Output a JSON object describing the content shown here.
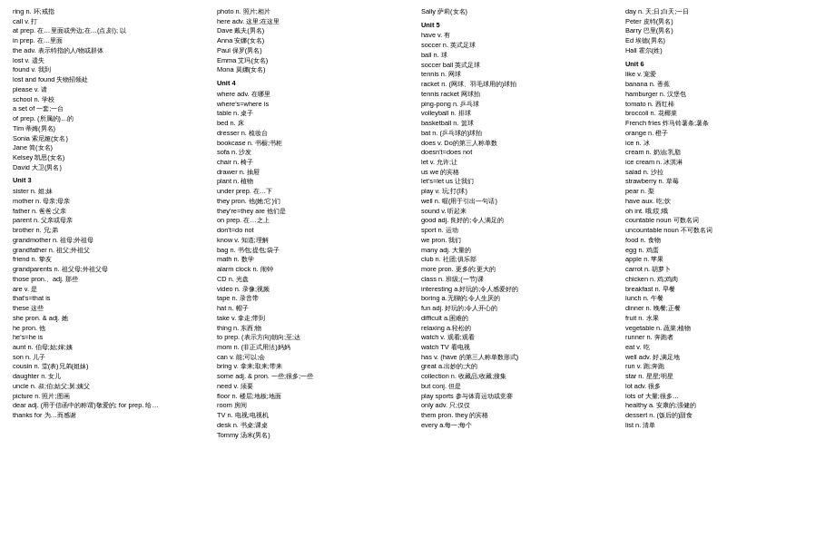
{
  "columns": [
    {
      "id": "col1",
      "entries": [
        "ring n. 环;戒指",
        "call v. 打",
        "at prep. 在…里面或旁边;在…(点,刻); 以",
        "in prep. 在…里面",
        "the adv. 表示特指的人/物或群体",
        "lost v. 遗失",
        "found v. 我到",
        "lost and found 失物招领处",
        "please v. 请",
        "school n. 学校",
        "a set of 一套;一台",
        "of prep. (所属的)…的",
        "Tim 蒂姆(男名)",
        "Sonia 索尼娅(女名)",
        "Jane 简(女名)",
        "Kelsey 凯思(女名)",
        "David 大卫(男名)",
        "Unit 3",
        "sister n. 姐;妹",
        "mother n. 母亲;母亲",
        "father n. 爸爸;父亲",
        "parent n. 父亲或母亲",
        "brother n. 兄;弟",
        "grandmother n. 祖母;外祖母",
        "grandfather n. 祖父;外祖父",
        "friend n. 挚友",
        "grandparents n. 祖父母;外祖父母",
        "those pron.、adj. 那些",
        "are v. 是",
        "that's=that is",
        "these 这些",
        "she pron. & adj. 她",
        "he pron. 他",
        "he's=he is",
        "aunt n. 伯母;姑;婶;姨",
        "son n. 儿子",
        "cousin n. 堂(表)兄弟(姐妹)",
        "daughter n. 女儿",
        "uncle n. 叔;伯;姑父;舅;姨父",
        "picture n. 照片;图画",
        "dear adj. (用于信函中的称谓)敬爱的; for prep. 给…",
        "thanks for 为…而感谢"
      ]
    },
    {
      "id": "col2",
      "entries": [
        "photo n. 照片;相片",
        "here adv. 这里;在这里",
        "Dave 戴夫(男名)",
        "Anna 安娜(女名)",
        "Paul 保罗(男名)",
        "Emma 艾玛(女名)",
        "Mona 莫娜(女名)",
        "Unit 4",
        "where adv. 在哪里",
        "where's=where is",
        "table n. 桌子",
        "bed n. 床",
        "dresser n. 梳妆台",
        "bookcase n. 书橱;书柜",
        "sofa n. 沙发",
        "chair n. 椅子",
        "drawer n. 抽屉",
        "plant n. 植物",
        "under prep. 在…下",
        "they pron. 他(她;它)们",
        "they're=they are 他们是",
        "on prep. 在…之上",
        "don't=do not",
        "know v. 知道;理解",
        "bag n. 书包;提包;袋子",
        "math n. 数学",
        "alarm clock n. 闹钟",
        "CD n. 光盘",
        "video n. 录像;视频",
        "tape n. 录音带",
        "hat n. 帽子",
        "take v. 拿走;带到",
        "thing n. 东西;物",
        "to prep. (表示方向)朝向;至;达",
        "mom n. (非正式用法)妈妈",
        "can v. 能;可以;会",
        "bring v. 拿来;取来;带来",
        "some adj. & pron. 一些;很多;一些",
        "need v. 须要",
        "floor n. 楼层;地板;地面",
        "room 房间",
        "TV n. 电视;电视机",
        "desk n. 书桌;课桌",
        "Tommy 汤米(男名)"
      ]
    },
    {
      "id": "col3",
      "entries": [
        "Sally 萨莉(女名)",
        "Unit 5",
        "have v. 有",
        "soccer n. 英式足球",
        "ball n. 球",
        "soccer ball 英式足球",
        "tennis n. 网球",
        "racket n. (网球、羽毛球用的)球拍",
        "tennis racket 网球拍",
        "ping-pong n. 乒乓球",
        "volleyball n. 排球",
        "basketball n. 篮球",
        "bat n. (乒乓球的)球拍",
        "does v. Do的第三人称单数",
        "doesn't=does not",
        "let v. 允许;让",
        "us we 的宾格",
        "let's=let us 让我们",
        "play v. 玩;打(球)",
        "well n. 喔(用于引出一句话)",
        "sound v. 听起来",
        "good adj. 良好的;令人满足的",
        "sport n. 运动",
        "we pron. 我们",
        "many adj. 大量的",
        "club n. 社团;俱乐部",
        "more pron. 更多的;更大的",
        "class n. 班级;(一节)课",
        "interesting a.好玩的;令人感爱好的",
        "boring a.无聊的;令人生厌的",
        "fun adj. 好玩的;令人开心的",
        "difficult a.困难的",
        "relaxing a.轻松的",
        "watch v. 观看;观看",
        "watch TV 看电视",
        "has v. (have 的第三人称单数形式)",
        "great a.出妙的;大的",
        "collection n. 收藏品;收藏;搜集",
        "but conj. 但是",
        "play sports 参与体育运动或竞赛",
        "only adv. 只;仅仅",
        "them pron. they 的宾格",
        "every a.每一;每个"
      ]
    },
    {
      "id": "col4",
      "entries": [
        "day n. 天;日;白天;一日",
        "Peter 皮特(男名)",
        "Barry 巴里(男名)",
        "Ed 埃德(男名)",
        "Hall 霍尔(姓)",
        "Unit 6",
        "like v. 宠爱",
        "banana n. 香蕉",
        "hamburger n. 汉堡包",
        "tomato n. 西红柿",
        "broccoli n. 花椰菜",
        "French fries 炸马铃薯条;薯条",
        "orange n. 橙子",
        "ice n. 冰",
        "cream n. 奶油;乳脂",
        "ice cream n. 冰淇淋",
        "salad n. 沙拉",
        "strawberry n. 草莓",
        "pear n. 梨",
        "have aux. 吃;饮",
        "oh int. 哦;哎;哦",
        "countable noun 可数名词",
        "uncountable noun 不可数名词",
        "food n. 食物",
        "egg n. 鸡蛋",
        "apple n. 苹果",
        "carrot n. 胡萝卜",
        "chicken n. 鸡;鸡肉",
        "breakfast n. 早餐",
        "lunch n. 午餐",
        "dinner n. 晚餐;正餐",
        "fruit n. 水果",
        "vegetable n. 蔬菜;植物",
        "runner n. 奔跑者",
        "eat v. 吃",
        "well adv. 好,满足地",
        "run v. 跑;奔跑",
        "star n. 星星;明星",
        "lot adv. 很多",
        "lots of 大量;很多…",
        "healthy a. 安康的;强健的",
        "dessert n. (饭后的)甜食",
        "list n. 清单"
      ]
    }
  ]
}
